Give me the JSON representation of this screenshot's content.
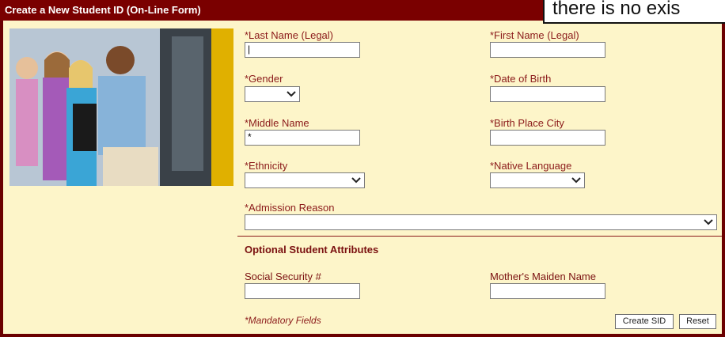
{
  "window": {
    "title": "Create a New Student ID (On-Line Form)"
  },
  "callout": {
    "text": "there is no exis"
  },
  "photo": {
    "alt_icon": "students-photo"
  },
  "form": {
    "last_name_label": "*Last Name (Legal)",
    "last_name_value": "|",
    "first_name_label": "*First Name (Legal)",
    "gender_label": "*Gender",
    "dob_label": "*Date of Birth",
    "middle_name_label": "*Middle Name",
    "middle_name_value": "*",
    "birth_city_label": "*Birth Place City",
    "ethnicity_label": "*Ethnicity",
    "native_language_label": "*Native Language",
    "admission_reason_label": "*Admission Reason",
    "optional_section_title": "Optional Student Attributes",
    "ssn_label": "Social Security #",
    "mothers_maiden_label": "Mother's Maiden Name",
    "mandatory_note": "*Mandatory Fields",
    "create_button": "Create SID",
    "reset_button": "Reset"
  },
  "colors": {
    "title_bar": "#7a0000",
    "form_bg": "#fdf5c9",
    "label": "#8b1a1a"
  }
}
